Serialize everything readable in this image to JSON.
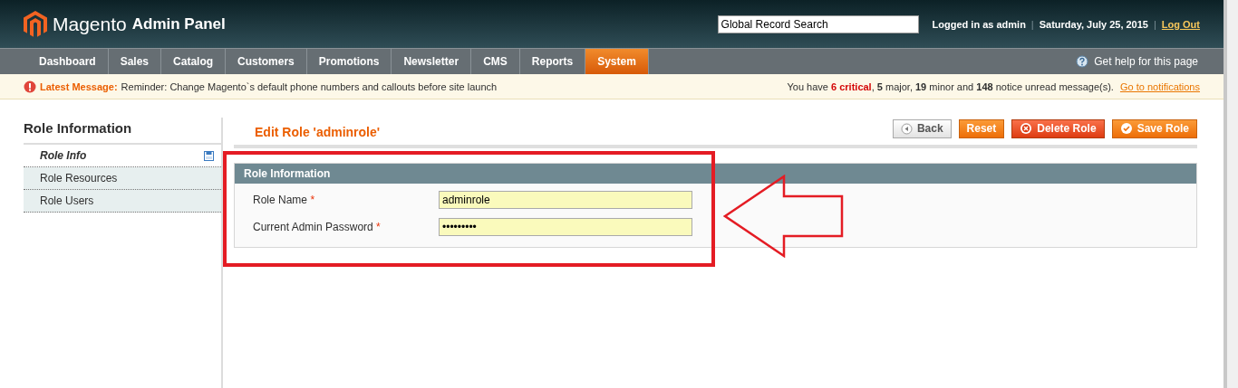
{
  "header": {
    "logo": "Magento",
    "logo_suffix": "Admin Panel",
    "search": {
      "value": "Global Record Search"
    },
    "user": "Logged in as admin",
    "date": "Saturday, July 25, 2015",
    "separators": [
      "|",
      "|"
    ],
    "logout": "Log Out"
  },
  "nav": [
    {
      "label": "Dashboard",
      "selected": false
    },
    {
      "label": "Sales",
      "selected": false
    },
    {
      "label": "Catalog",
      "selected": false
    },
    {
      "label": "Customers",
      "selected": false
    },
    {
      "label": "Promotions",
      "selected": false
    },
    {
      "label": "Newsletter",
      "selected": false
    },
    {
      "label": "CMS",
      "selected": false
    },
    {
      "label": "Reports",
      "selected": false
    },
    {
      "label": "System",
      "selected": true
    }
  ],
  "help": "Get help for this page",
  "message": {
    "label": "Latest Message:",
    "text": "Reminder: Change Magento`s default phone numbers and callouts before site launch",
    "summary": "You have **6 critical**, **5** major, **19** minor and **148** notice unread message(s).",
    "link": "Go to notifications"
  },
  "sidebar": {
    "title": "Role Information",
    "tabs": [
      {
        "label": "Role Info",
        "selected": true
      },
      {
        "label": "Role Resources",
        "selected": false
      },
      {
        "label": "Role Users",
        "selected": false
      }
    ]
  },
  "page_title": "Edit Role 'adminrole'",
  "buttons": [
    {
      "label": "Back",
      "kind": "back"
    },
    {
      "label": "Reset",
      "kind": "plain"
    },
    {
      "label": "Delete Role",
      "kind": "delete"
    },
    {
      "label": "Save Role",
      "kind": "save"
    }
  ],
  "fieldset": {
    "title": "Role Information",
    "fields": [
      {
        "label": "Role Name",
        "required_mark": "*",
        "value": "adminrole"
      },
      {
        "label": "Current Admin Password",
        "required_mark": "*",
        "value": "•••••••••"
      }
    ]
  }
}
